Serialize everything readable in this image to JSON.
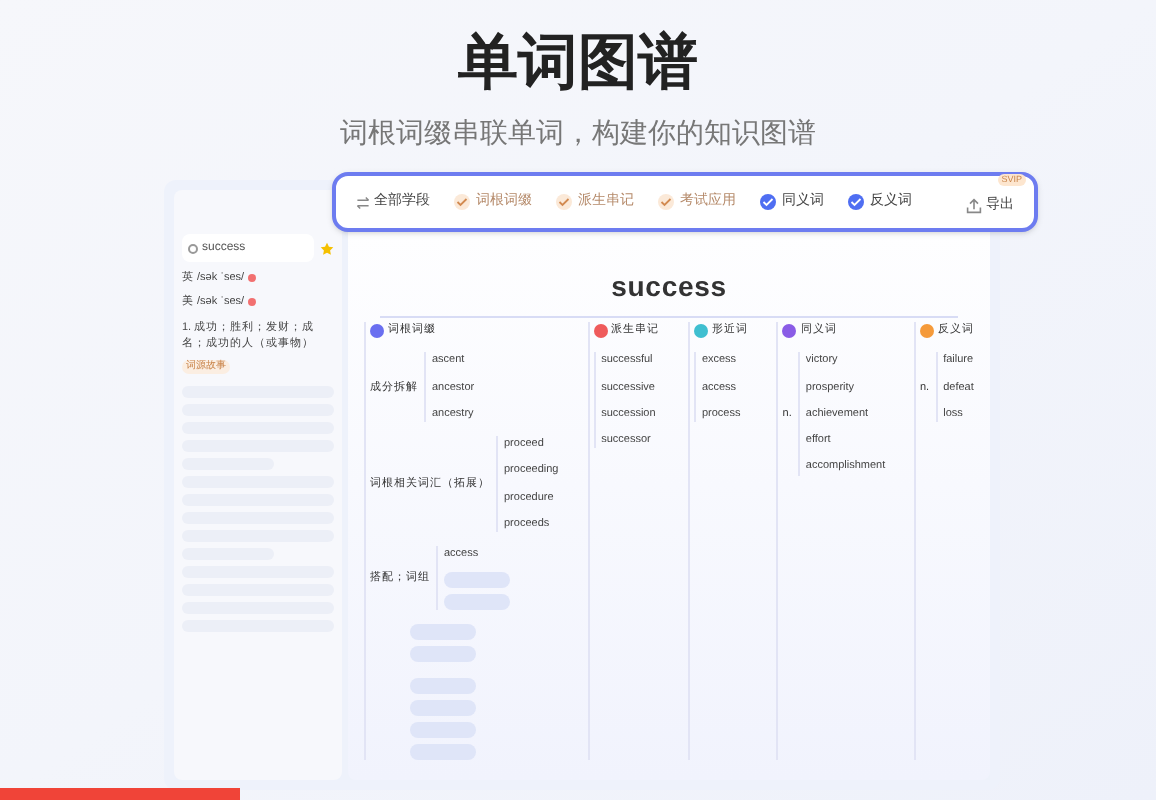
{
  "title": "单词图谱",
  "subtitle": "词根词缀串联单词，构建你的知识图谱",
  "toolbar": {
    "stage": "全部学段",
    "filters": [
      {
        "label": "词根词缀",
        "checked": true,
        "disabled": true
      },
      {
        "label": "派生串记",
        "checked": true,
        "disabled": true
      },
      {
        "label": "考试应用",
        "checked": true,
        "disabled": true
      },
      {
        "label": "同义词",
        "checked": true,
        "disabled": false
      },
      {
        "label": "反义词",
        "checked": true,
        "disabled": false
      }
    ],
    "export": "导出",
    "badge": "SVIP"
  },
  "sidebar": {
    "search": {
      "value": "success"
    },
    "starred": true,
    "phonetics": [
      {
        "region": "英",
        "ipa": "/sək ˈses/"
      },
      {
        "region": "美",
        "ipa": "/sək ˈses/"
      }
    ],
    "definition": "1. 成功；胜利；发财；成名；成功的人（或事物）",
    "note_tag": "词源故事"
  },
  "map": {
    "root": "success",
    "branches": [
      {
        "label": "词根词缀",
        "color": "#6a6ff0",
        "groups": [
          {
            "label": "成分拆解",
            "items": [
              "ascent",
              "ancestor",
              "ancestry"
            ]
          },
          {
            "label": "词根相关词汇（拓展）",
            "items": [
              "proceed",
              "proceeding",
              "procedure",
              "proceeds"
            ]
          },
          {
            "label": "搭配；词组",
            "items": [
              "access"
            ]
          }
        ]
      },
      {
        "label": "派生串记",
        "color": "#ef5b5b",
        "groups": [
          {
            "items": [
              "successful",
              "successive",
              "succession",
              "successor"
            ]
          }
        ]
      },
      {
        "label": "形近词",
        "color": "#3fbfd0",
        "groups": [
          {
            "items": [
              "excess",
              "access",
              "process"
            ]
          }
        ]
      },
      {
        "label": "同义词",
        "color": "#8a5ce6",
        "groups": [
          {
            "label": "n.",
            "items": [
              "victory",
              "prosperity",
              "achievement",
              "effort",
              "accomplishment"
            ]
          }
        ]
      },
      {
        "label": "反义词",
        "color": "#f59a3a",
        "groups": [
          {
            "label": "n.",
            "items": [
              "failure",
              "defeat",
              "loss"
            ]
          }
        ]
      }
    ]
  }
}
